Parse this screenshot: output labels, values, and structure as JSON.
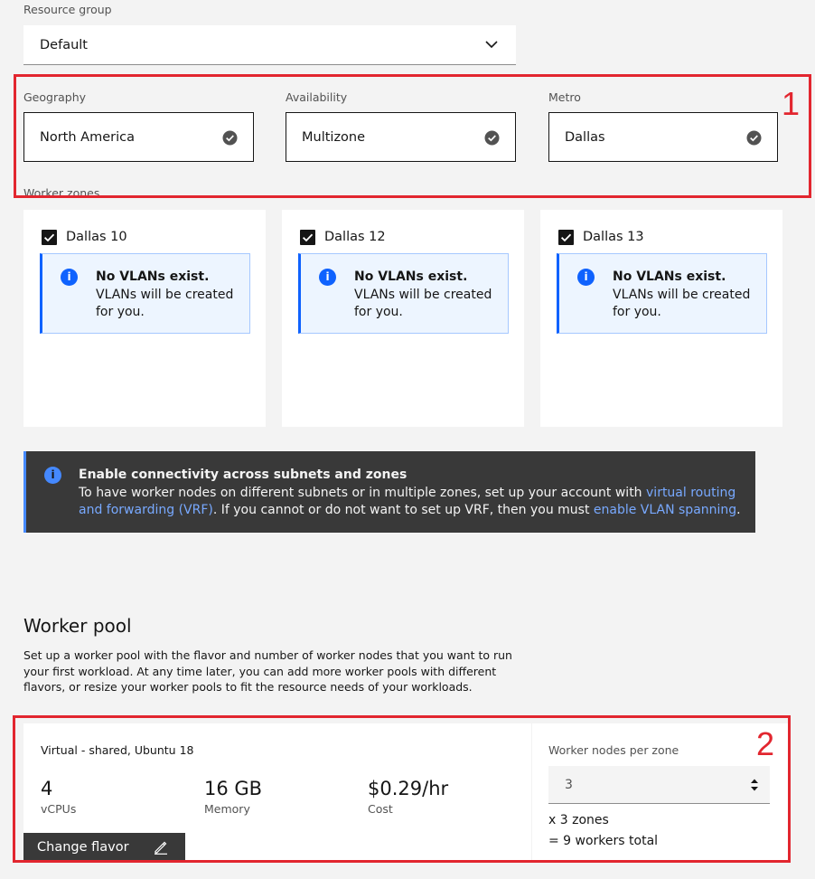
{
  "resource_group": {
    "label": "Resource group",
    "value": "Default"
  },
  "location": {
    "geography": {
      "label": "Geography",
      "value": "North America"
    },
    "availability": {
      "label": "Availability",
      "value": "Multizone"
    },
    "metro": {
      "label": "Metro",
      "value": "Dallas"
    }
  },
  "worker_zones": {
    "label": "Worker zones",
    "zones": [
      {
        "name": "Dallas 10",
        "checked": true,
        "note_title": "No VLANs exist.",
        "note_body": "VLANs will be created for you."
      },
      {
        "name": "Dallas 12",
        "checked": true,
        "note_title": "No VLANs exist.",
        "note_body": "VLANs will be created for you."
      },
      {
        "name": "Dallas 13",
        "checked": true,
        "note_title": "No VLANs exist.",
        "note_body": "VLANs will be created for you."
      }
    ]
  },
  "connectivity_banner": {
    "title": "Enable connectivity across subnets and zones",
    "body_1": "To have worker nodes on different subnets or in multiple zones, set up your account with ",
    "link_vrf": "virtual routing and forwarding (VRF)",
    "body_2": ". If you cannot or do not want to set up VRF, then you must ",
    "link_vlan": "enable VLAN spanning",
    "body_3": "."
  },
  "worker_pool": {
    "heading": "Worker pool",
    "description": "Set up a worker pool with the flavor and number of worker nodes that you want to run your first workload. At any time later, you can add more worker pools with different flavors, or resize your worker pools to fit the resource needs of your workloads.",
    "flavor": {
      "type_bold": "Virtual",
      "type_rest": " - shared, Ubuntu 18",
      "vcpus_value": "4",
      "vcpus_label": "vCPUs",
      "memory_value": "16 GB",
      "memory_label": "Memory",
      "cost_value": "$0.29/hr",
      "cost_label": "Cost",
      "change_button": "Change flavor"
    },
    "nodes": {
      "label": "Worker nodes per zone",
      "value": "3",
      "zones_line": "x 3 zones",
      "total_line": "= 9 workers total"
    }
  },
  "annotations": {
    "box1": "1",
    "box2": "2"
  },
  "colors": {
    "accent": "#0f62fe",
    "annotation": "#e2262f",
    "banner_bg": "#393939",
    "link": "#78a9ff"
  },
  "icons": [
    "chevron-down-icon",
    "checkmark-filled-icon",
    "checkbox-checked-icon",
    "info-icon",
    "edit-icon",
    "caret-up-down-icon"
  ]
}
